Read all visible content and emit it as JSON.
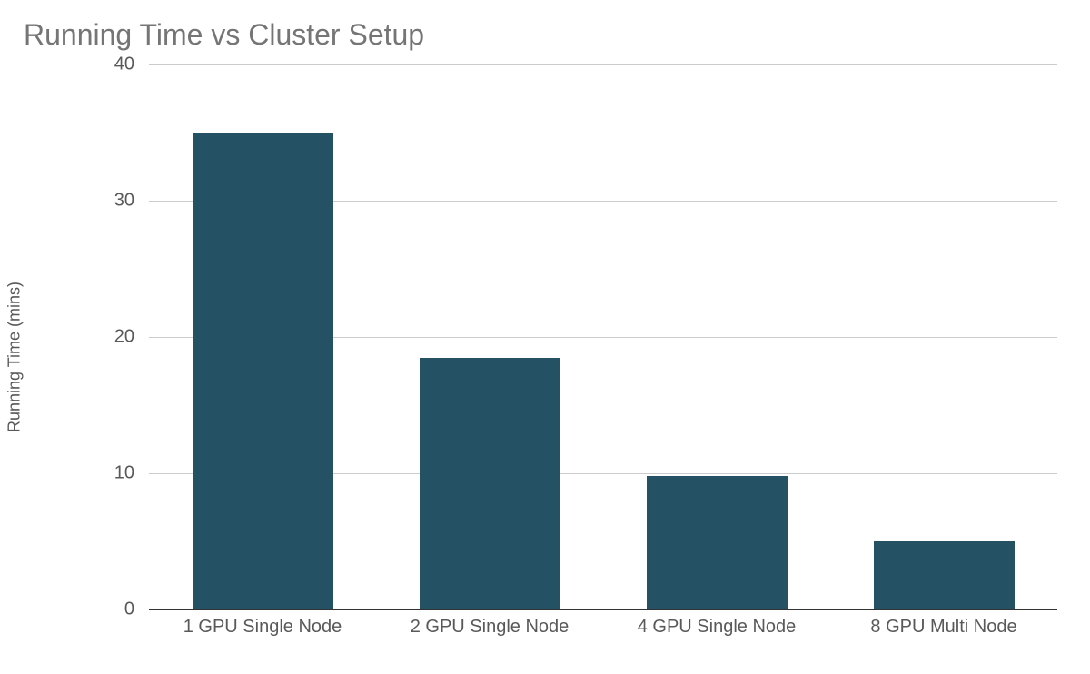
{
  "chart_data": {
    "type": "bar",
    "title": "Running Time vs Cluster Setup",
    "xlabel": "",
    "ylabel": "Running Time (mins)",
    "ylim": [
      0,
      40
    ],
    "yticks": [
      0,
      10,
      20,
      30,
      40
    ],
    "categories": [
      "1 GPU Single Node",
      "2 GPU Single Node",
      "4 GPU Single Node",
      "8 GPU Multi Node"
    ],
    "values": [
      35,
      18.5,
      9.8,
      5
    ],
    "bar_color": "#255165",
    "grid_color": "#cccccc",
    "axis_text_color": "#595959",
    "title_color": "#757575"
  }
}
